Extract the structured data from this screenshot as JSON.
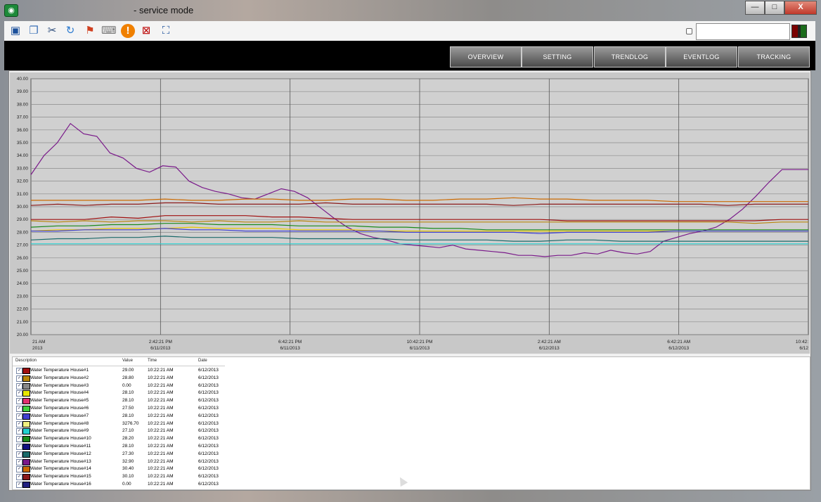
{
  "window": {
    "title": "- service mode",
    "min_label": "—",
    "max_label": "□",
    "close_label": "X"
  },
  "toolbar": {
    "icons": [
      "monitor-icon",
      "windows-icon",
      "tools-icon",
      "refresh-icon",
      "windows-flag-icon",
      "keyboard-icon",
      "alert-icon",
      "network-disconnect-icon",
      "fullscreen-icon"
    ],
    "search_value": ""
  },
  "nav": {
    "tabs": [
      "OVERVIEW",
      "SETTING",
      "TRENDLOG",
      "EVENTLOG",
      "TRACKING"
    ]
  },
  "chart_data": {
    "type": "line",
    "title": "",
    "xlabel": "",
    "ylabel": "",
    "ylim": [
      20.0,
      40.0
    ],
    "y_ticks": [
      "40.00",
      "39.00",
      "38.00",
      "37.00",
      "36.00",
      "35.00",
      "34.00",
      "33.00",
      "32.00",
      "31.00",
      "30.00",
      "29.00",
      "28.00",
      "27.00",
      "26.00",
      "25.00",
      "24.00",
      "23.00",
      "22.00",
      "21.00",
      "20.00"
    ],
    "x_ticks": [
      {
        "time": "21 AM",
        "date": "2013"
      },
      {
        "time": "2:42:21 PM",
        "date": "6/11/2013"
      },
      {
        "time": "6:42:21 PM",
        "date": "6/11/2013"
      },
      {
        "time": "10:42:21 PM",
        "date": "6/11/2013"
      },
      {
        "time": "2:42:21 AM",
        "date": "6/12/2013"
      },
      {
        "time": "6:42:21 AM",
        "date": "6/12/2013"
      },
      {
        "time": "10:42:",
        "date": "6/12"
      }
    ],
    "grid": true,
    "series": [
      {
        "name": "Water Temperature House#13",
        "color": "#7a1a8a",
        "values": [
          32.5,
          34.0,
          35.0,
          36.5,
          35.7,
          35.5,
          34.2,
          33.8,
          33.0,
          32.7,
          33.2,
          33.1,
          32.0,
          31.5,
          31.2,
          31.0,
          30.7,
          30.6,
          31.0,
          31.4,
          31.2,
          30.7,
          29.9,
          29.1,
          28.4,
          27.9,
          27.6,
          27.4,
          27.1,
          27.0,
          26.9,
          26.8,
          27.0,
          26.7,
          26.6,
          26.5,
          26.4,
          26.2,
          26.2,
          26.1,
          26.2,
          26.2,
          26.4,
          26.3,
          26.6,
          26.4,
          26.3,
          26.5,
          27.3,
          27.6,
          27.9,
          28.1,
          28.4,
          29.0,
          29.8,
          30.8,
          31.9,
          32.9,
          32.9,
          32.9
        ]
      },
      {
        "name": "Water Temperature House#14",
        "color": "#cc6a00",
        "values": [
          30.5,
          30.5,
          30.5,
          30.5,
          30.5,
          30.6,
          30.5,
          30.5,
          30.6,
          30.6,
          30.5,
          30.5,
          30.6,
          30.6,
          30.5,
          30.5,
          30.6,
          30.6,
          30.7,
          30.6,
          30.6,
          30.5,
          30.5,
          30.5,
          30.4,
          30.4,
          30.4,
          30.4,
          30.4,
          30.4
        ]
      },
      {
        "name": "Water Temperature House#15",
        "color": "#8b1a1a",
        "values": [
          30.1,
          30.2,
          30.1,
          30.2,
          30.2,
          30.3,
          30.3,
          30.2,
          30.2,
          30.2,
          30.2,
          30.3,
          30.2,
          30.2,
          30.2,
          30.2,
          30.2,
          30.2,
          30.1,
          30.2,
          30.2,
          30.2,
          30.2,
          30.2,
          30.2,
          30.2,
          30.1,
          30.2,
          30.2,
          30.2
        ]
      },
      {
        "name": "Water Temperature House#1",
        "color": "#a01010",
        "values": [
          29.0,
          29.0,
          29.0,
          29.2,
          29.1,
          29.3,
          29.3,
          29.3,
          29.3,
          29.2,
          29.2,
          29.1,
          29.0,
          29.0,
          29.0,
          29.0,
          29.0,
          29.0,
          29.0,
          29.0,
          28.9,
          28.9,
          28.9,
          28.9,
          28.9,
          28.9,
          28.9,
          28.9,
          29.0,
          29.0
        ]
      },
      {
        "name": "Water Temperature House#2",
        "color": "#b8860b",
        "values": [
          28.9,
          28.8,
          28.9,
          28.8,
          28.9,
          28.9,
          28.8,
          28.9,
          28.8,
          28.8,
          28.9,
          28.8,
          28.8,
          28.8,
          28.8,
          28.8,
          28.8,
          28.8,
          28.8,
          28.8,
          28.8,
          28.8,
          28.8,
          28.8,
          28.8,
          28.8,
          28.8,
          28.7,
          28.8,
          28.8
        ]
      },
      {
        "name": "Water Temperature House#10",
        "color": "#1a8a1a",
        "values": [
          28.4,
          28.5,
          28.5,
          28.6,
          28.6,
          28.7,
          28.7,
          28.6,
          28.6,
          28.6,
          28.5,
          28.5,
          28.5,
          28.4,
          28.4,
          28.3,
          28.3,
          28.2,
          28.2,
          28.2,
          28.2,
          28.2,
          28.2,
          28.2,
          28.2,
          28.2,
          28.2,
          28.2,
          28.2,
          28.2
        ]
      },
      {
        "name": "Water Temperature House#4",
        "color": "#e8c800",
        "values": [
          28.1,
          28.2,
          28.2,
          28.3,
          28.3,
          28.3,
          28.4,
          28.3,
          28.3,
          28.3,
          28.2,
          28.2,
          28.2,
          28.1,
          28.1,
          28.1,
          28.1,
          28.1,
          28.1,
          28.1,
          28.1,
          28.1,
          28.1,
          28.1,
          28.1,
          28.1,
          28.1,
          28.1,
          28.1,
          28.1
        ]
      },
      {
        "name": "Water Temperature House#7",
        "color": "#4040d0",
        "values": [
          28.1,
          28.1,
          28.2,
          28.2,
          28.2,
          28.3,
          28.2,
          28.2,
          28.1,
          28.1,
          28.1,
          28.1,
          28.1,
          28.1,
          28.0,
          28.0,
          28.0,
          28.0,
          28.0,
          27.9,
          28.0,
          28.0,
          28.0,
          28.0,
          28.1,
          28.1,
          28.1,
          28.1,
          28.1,
          28.1
        ]
      },
      {
        "name": "Water Temperature House#12",
        "color": "#1a6a6a",
        "values": [
          27.4,
          27.5,
          27.5,
          27.6,
          27.6,
          27.7,
          27.6,
          27.6,
          27.6,
          27.6,
          27.5,
          27.5,
          27.5,
          27.5,
          27.4,
          27.4,
          27.4,
          27.4,
          27.3,
          27.3,
          27.4,
          27.4,
          27.3,
          27.3,
          27.3,
          27.3,
          27.3,
          27.3,
          27.3,
          27.3
        ]
      },
      {
        "name": "Water Temperature House#9",
        "color": "#20d0d0",
        "values": [
          27.1,
          27.1,
          27.1,
          27.1,
          27.1,
          27.1,
          27.1,
          27.1,
          27.1,
          27.1,
          27.1,
          27.1,
          27.1,
          27.1,
          27.1,
          27.1,
          27.1,
          27.1,
          27.1,
          27.1,
          27.1,
          27.1,
          27.1,
          27.1,
          27.1,
          27.1,
          27.1,
          27.1,
          27.1,
          27.1
        ]
      }
    ]
  },
  "legend": {
    "headers": {
      "description": "Description",
      "value": "Value",
      "time": "Time",
      "date": "Date"
    },
    "rows": [
      {
        "name": "Water Temperature House#1",
        "value": "29.00",
        "time": "10:22:21  AM",
        "date": "6/12/2013",
        "color": "#a01010"
      },
      {
        "name": "Water Temperature House#2",
        "value": "28.80",
        "time": "10:22:21  AM",
        "date": "6/12/2013",
        "color": "#b8860b"
      },
      {
        "name": "Water Temperature House#3",
        "value": "0.00",
        "time": "10:22:21  AM",
        "date": "6/12/2013",
        "color": "#888888"
      },
      {
        "name": "Water Temperature House#4",
        "value": "28.10",
        "time": "10:22:21  AM",
        "date": "6/12/2013",
        "color": "#e8e800"
      },
      {
        "name": "Water Temperature House#5",
        "value": "28.10",
        "time": "10:22:21  AM",
        "date": "6/12/2013",
        "color": "#e03070"
      },
      {
        "name": "Water Temperature House#6",
        "value": "27.50",
        "time": "10:22:21  AM",
        "date": "6/12/2013",
        "color": "#40d040"
      },
      {
        "name": "Water Temperature House#7",
        "value": "28.10",
        "time": "10:22:21  AM",
        "date": "6/12/2013",
        "color": "#4040d0"
      },
      {
        "name": "Water Temperature House#8",
        "value": "3276.70",
        "time": "10:22:21  AM",
        "date": "6/12/2013",
        "color": "#f0f080"
      },
      {
        "name": "Water Temperature House#9",
        "value": "27.10",
        "time": "10:22:21  AM",
        "date": "6/12/2013",
        "color": "#20d0d0"
      },
      {
        "name": "Water Temperature House#10",
        "value": "28.20",
        "time": "10:22:21  AM",
        "date": "6/12/2013",
        "color": "#1a8a1a"
      },
      {
        "name": "Water Temperature House#11",
        "value": "28.10",
        "time": "10:22:21  AM",
        "date": "6/12/2013",
        "color": "#101080"
      },
      {
        "name": "Water Temperature House#12",
        "value": "27.30",
        "time": "10:22:21  AM",
        "date": "6/12/2013",
        "color": "#1a6a6a"
      },
      {
        "name": "Water Temperature House#13",
        "value": "32.90",
        "time": "10:22:21  AM",
        "date": "6/12/2013",
        "color": "#7a1a8a"
      },
      {
        "name": "Water Temperature House#14",
        "value": "30.40",
        "time": "10:22:21  AM",
        "date": "6/12/2013",
        "color": "#cc6a00"
      },
      {
        "name": "Water Temperature House#15",
        "value": "30.10",
        "time": "10:22:21  AM",
        "date": "6/12/2013",
        "color": "#8b1a1a"
      },
      {
        "name": "Water Temperature House#16",
        "value": "0.00",
        "time": "10:22:21  AM",
        "date": "6/12/2013",
        "color": "#202080"
      }
    ]
  }
}
